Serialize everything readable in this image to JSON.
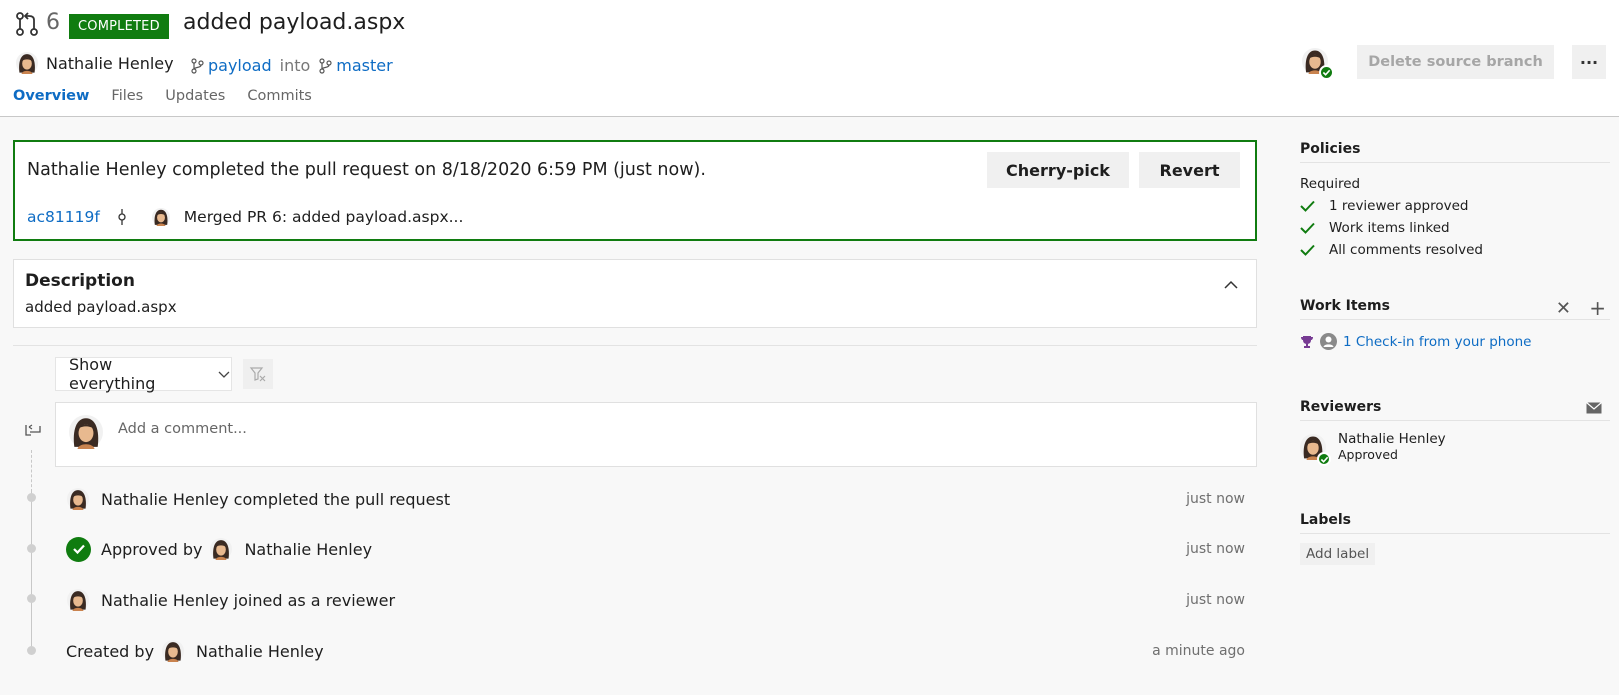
{
  "header": {
    "pr_number": "6",
    "status_badge": "COMPLETED",
    "title": "added payload.aspx",
    "author": "Nathalie Henley",
    "source_branch": "payload",
    "into_text": "into",
    "target_branch": "master",
    "delete_branch_label": "Delete source branch",
    "more_label": "···"
  },
  "tabs": [
    {
      "label": "Overview",
      "active": true
    },
    {
      "label": "Files"
    },
    {
      "label": "Updates"
    },
    {
      "label": "Commits"
    }
  ],
  "completion": {
    "message": "Nathalie Henley completed the pull request on 8/18/2020 6:59 PM (just now).",
    "cherry_pick_label": "Cherry-pick",
    "revert_label": "Revert",
    "commit_id": "ac81119f",
    "commit_message": "Merged PR 6: added payload.aspx..."
  },
  "description": {
    "title": "Description",
    "text": "added payload.aspx"
  },
  "filter": {
    "selected": "Show everything"
  },
  "comment": {
    "placeholder": "Add a comment..."
  },
  "timeline": [
    {
      "text": "Nathalie Henley completed the pull request",
      "time": "just now"
    },
    {
      "prefix": "Approved by",
      "name": "Nathalie Henley",
      "time": "just now"
    },
    {
      "text": "Nathalie Henley joined as a reviewer",
      "time": "just now"
    },
    {
      "prefix": "Created by",
      "name": "Nathalie Henley",
      "time": "a minute ago"
    }
  ],
  "sidebar": {
    "policies": {
      "title": "Policies",
      "required_label": "Required",
      "items": [
        "1 reviewer approved",
        "Work items linked",
        "All comments resolved"
      ]
    },
    "work_items": {
      "title": "Work Items",
      "item_label": "1 Check-in from your phone"
    },
    "reviewers": {
      "title": "Reviewers",
      "name": "Nathalie Henley",
      "status": "Approved"
    },
    "labels": {
      "title": "Labels",
      "add_label": "Add label"
    }
  },
  "colors": {
    "accent": "#0e6cc4",
    "success": "#107c10"
  }
}
